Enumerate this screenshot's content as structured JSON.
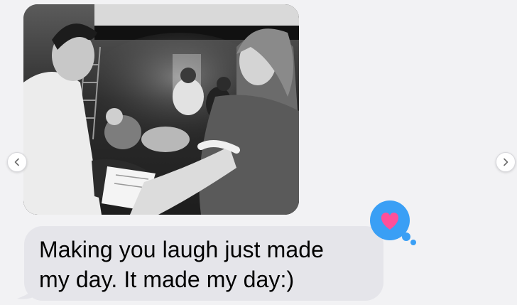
{
  "message": {
    "text_line1": "Making you laugh just made",
    "text_line2": "my day. It made my day:)"
  },
  "photo": {
    "description_icon": "photo-attachment"
  },
  "reaction": {
    "icon": "heart-icon",
    "bubble_color": "#3a9ff5",
    "heart_color": "#ff4f9a"
  },
  "carousel": {
    "prev_icon": "chevron-left-icon",
    "next_icon": "chevron-right-icon"
  },
  "colors": {
    "background": "#f2f2f4",
    "received_bubble": "#e5e5ea",
    "text": "#000000"
  }
}
